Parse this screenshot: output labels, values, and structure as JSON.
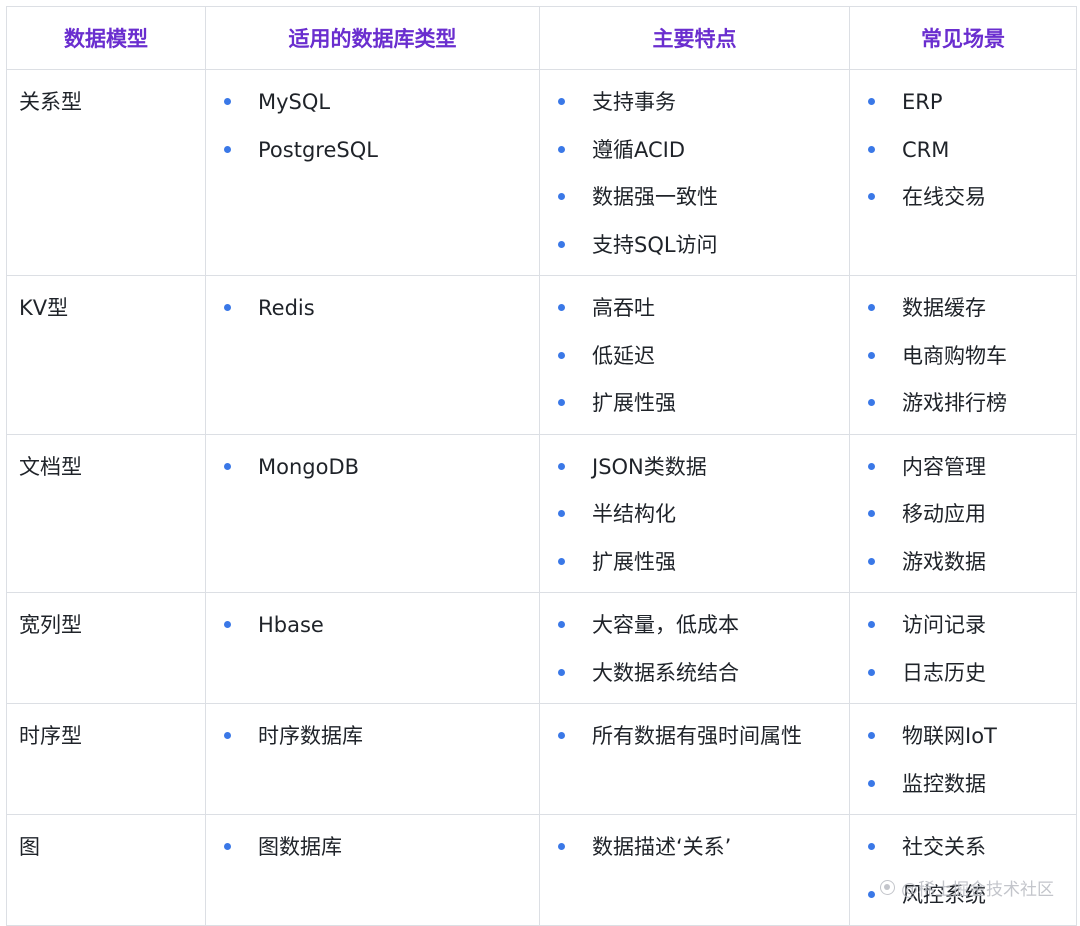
{
  "table": {
    "headers": [
      "数据模型",
      "适用的数据库类型",
      "主要特点",
      "常见场景"
    ],
    "rows": [
      {
        "model": "关系型",
        "databases": [
          "MySQL",
          "PostgreSQL"
        ],
        "features": [
          "支持事务",
          "遵循ACID",
          "数据强一致性",
          "支持SQL访问"
        ],
        "scenarios": [
          "ERP",
          "CRM",
          "在线交易"
        ]
      },
      {
        "model": "KV型",
        "databases": [
          "Redis"
        ],
        "features": [
          "高吞吐",
          "低延迟",
          "扩展性强"
        ],
        "scenarios": [
          "数据缓存",
          "电商购物车",
          "游戏排行榜"
        ]
      },
      {
        "model": "文档型",
        "databases": [
          "MongoDB"
        ],
        "features": [
          "JSON类数据",
          "半结构化",
          "扩展性强"
        ],
        "scenarios": [
          "内容管理",
          "移动应用",
          "游戏数据"
        ]
      },
      {
        "model": "宽列型",
        "databases": [
          "Hbase"
        ],
        "features": [
          "大容量，低成本",
          "大数据系统结合"
        ],
        "scenarios": [
          "访问记录",
          "日志历史"
        ]
      },
      {
        "model": "时序型",
        "databases": [
          "时序数据库"
        ],
        "features": [
          "所有数据有强时间属性"
        ],
        "scenarios": [
          "物联网IoT",
          "监控数据"
        ]
      },
      {
        "model": "图",
        "databases": [
          "图数据库"
        ],
        "features": [
          "数据描述‘关系’"
        ],
        "scenarios": [
          "社交关系",
          "风控系统"
        ]
      }
    ]
  },
  "watermark": {
    "text": "@稀土掘金技术社区",
    "icon": "juejin-logo-icon"
  },
  "colors": {
    "header_text": "#6a2ecf",
    "bullet": "#3a78e7",
    "border": "#dcdfe4"
  }
}
